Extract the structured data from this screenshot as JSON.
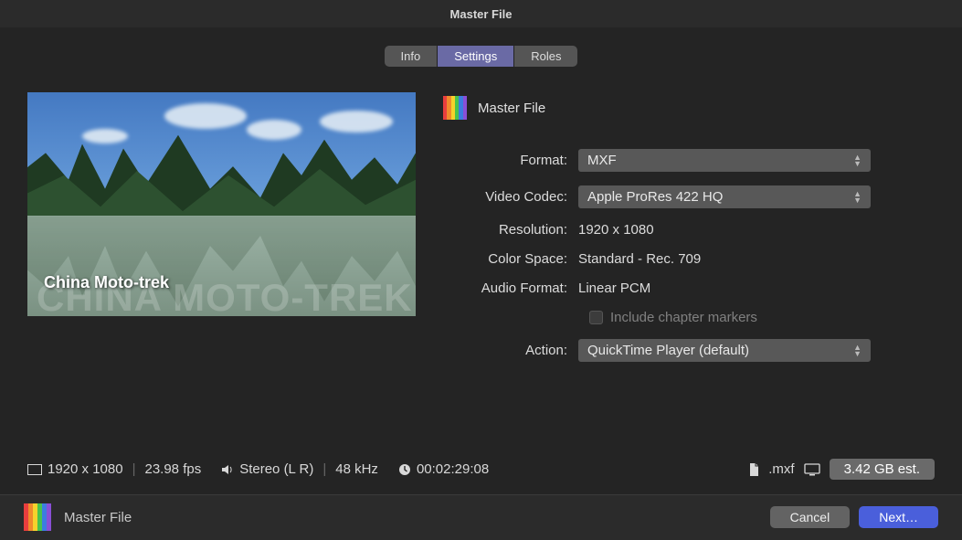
{
  "window": {
    "title": "Master File"
  },
  "tabs": {
    "info": "Info",
    "settings": "Settings",
    "roles": "Roles"
  },
  "preview": {
    "caption": "China Moto-trek",
    "ghost": "CHINA MOTO-TREK"
  },
  "panel": {
    "title": "Master File",
    "format": {
      "label": "Format:",
      "value": "MXF"
    },
    "video_codec": {
      "label": "Video Codec:",
      "value": "Apple ProRes 422 HQ"
    },
    "resolution": {
      "label": "Resolution:",
      "value": "1920 x 1080"
    },
    "color_space": {
      "label": "Color Space:",
      "value": "Standard - Rec. 709"
    },
    "audio_format": {
      "label": "Audio Format:",
      "value": "Linear PCM"
    },
    "chapter_markers": {
      "label": "Include chapter markers",
      "checked": false
    },
    "action": {
      "label": "Action:",
      "value": "QuickTime Player (default)"
    }
  },
  "status": {
    "resolution": "1920 x 1080",
    "fps": "23.98 fps",
    "audio": "Stereo (L R)",
    "khz": "48 kHz",
    "timecode": "00:02:29:08",
    "ext": ".mxf",
    "size": "3.42 GB est."
  },
  "footer": {
    "title": "Master File",
    "cancel": "Cancel",
    "next": "Next…"
  }
}
